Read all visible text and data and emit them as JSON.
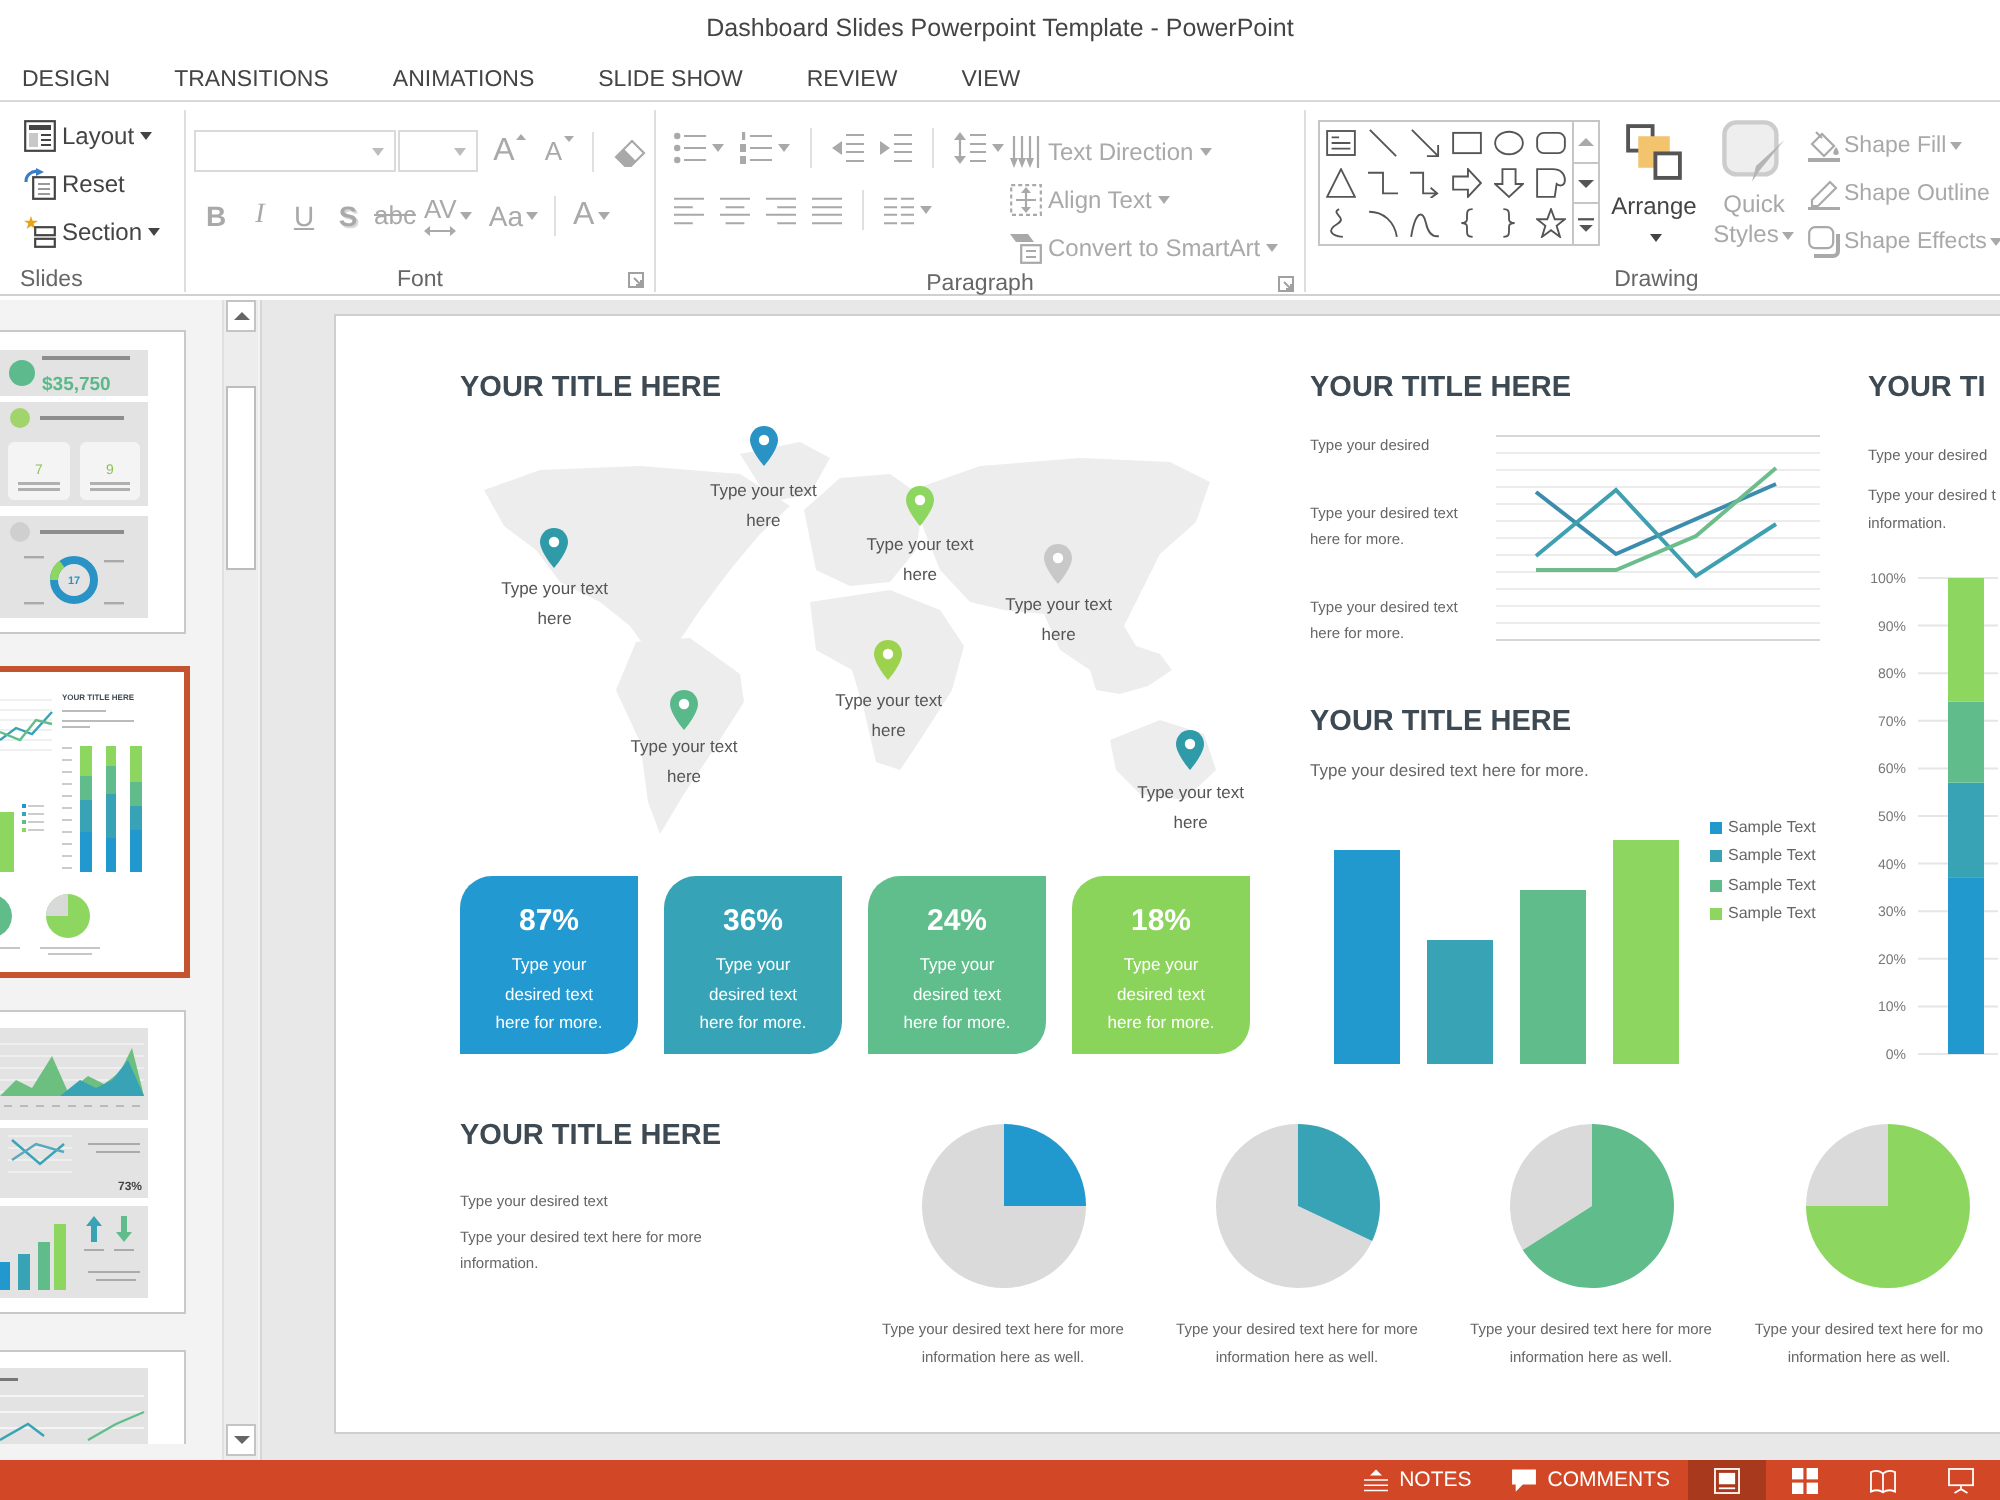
{
  "window": {
    "title": "Dashboard Slides Powerpoint Template - PowerPoint"
  },
  "tabs": [
    {
      "label": "DESIGN",
      "selected": false
    },
    {
      "label": "TRANSITIONS",
      "selected": false
    },
    {
      "label": "ANIMATIONS",
      "selected": false
    },
    {
      "label": "SLIDE SHOW",
      "selected": false
    },
    {
      "label": "REVIEW",
      "selected": false
    },
    {
      "label": "VIEW",
      "selected": false
    }
  ],
  "ribbon": {
    "slides_group": {
      "label": "Slides",
      "buttons": [
        {
          "label": "Layout",
          "menu": true,
          "disabled": false
        },
        {
          "label": "Reset",
          "menu": false,
          "disabled": false
        },
        {
          "label": "Section",
          "menu": true,
          "disabled": false
        }
      ]
    },
    "font_group": {
      "label": "Font",
      "font_name_field": {
        "disabled": true
      },
      "font_size_field": {
        "disabled": true
      },
      "size_buttons": [
        {
          "label": "A",
          "kind": "grow",
          "disabled": true
        },
        {
          "label": "A",
          "kind": "shrink",
          "disabled": true
        }
      ],
      "clear_button": {
        "disabled": true
      },
      "format_buttons": [
        {
          "label": "B",
          "kind": "bold",
          "menu": false,
          "disabled": true
        },
        {
          "label": "I",
          "kind": "italic",
          "menu": false,
          "disabled": true
        },
        {
          "label": "U",
          "kind": "underline",
          "menu": false,
          "disabled": true
        },
        {
          "label": "S",
          "kind": "shadow",
          "menu": false,
          "disabled": true
        },
        {
          "label": "abc",
          "kind": "strikethrough",
          "menu": false,
          "disabled": true
        },
        {
          "label": "AV",
          "kind": "spacing",
          "menu": true,
          "disabled": true
        },
        {
          "label": "Aa",
          "kind": "case",
          "menu": true,
          "disabled": true
        },
        {
          "label": "A",
          "kind": "color",
          "menu": true,
          "disabled": true
        }
      ]
    },
    "paragraph_group": {
      "label": "Paragraph",
      "list_buttons": [
        {
          "menu": true,
          "disabled": true
        },
        {
          "menu": true,
          "disabled": true
        },
        {
          "menu": false,
          "disabled": true
        },
        {
          "menu": false,
          "disabled": true
        },
        {
          "menu": true,
          "disabled": true
        }
      ],
      "align_buttons": [
        {
          "menu": false,
          "disabled": true
        },
        {
          "menu": false,
          "disabled": true
        },
        {
          "menu": false,
          "disabled": true
        },
        {
          "menu": false,
          "disabled": true
        },
        {
          "menu": true,
          "disabled": true
        }
      ],
      "text_buttons": [
        {
          "label": "Text Direction",
          "menu": true,
          "disabled": true
        },
        {
          "label": "Align Text",
          "menu": true,
          "disabled": true
        },
        {
          "label": "Convert to SmartArt",
          "menu": true,
          "disabled": true
        }
      ]
    },
    "drawing_group": {
      "label": "Drawing",
      "gallery_scroll": [
        {
          "disabled": true
        },
        {
          "disabled": false
        },
        {
          "disabled": false
        }
      ],
      "big_buttons": [
        {
          "label": "Arrange",
          "menu": true,
          "disabled": false
        },
        {
          "label": "Quick Styles",
          "menu": true,
          "disabled": true
        }
      ],
      "side_buttons": [
        {
          "label": "Shape Fill",
          "menu": true,
          "disabled": true
        },
        {
          "label": "Shape Outline",
          "menu": false,
          "disabled": true
        },
        {
          "label": "Shape Effects",
          "menu": true,
          "disabled": true
        }
      ]
    }
  },
  "thumbnails": [
    {
      "kind": "metrics",
      "selected": false,
      "texts": [
        "$35,750",
        "7",
        "9",
        "17"
      ]
    },
    {
      "kind": "dashboard",
      "selected": true,
      "texts": [
        "YOUR TITLE HERE"
      ]
    },
    {
      "kind": "trends",
      "selected": false,
      "texts": [
        "73%"
      ]
    },
    {
      "kind": "lines",
      "selected": false
    }
  ],
  "slide": {
    "map_section": {
      "title": "YOUR TITLE HERE",
      "pins": [
        {
          "label": "Type your text here",
          "color": "#2a93c5"
        },
        {
          "label": "Type your text here",
          "color": "#2f9aa8"
        },
        {
          "label": "Type your text here",
          "color": "#8dd65f"
        },
        {
          "label": "Type your text here",
          "color": "#c8c8c8"
        },
        {
          "label": "Type your text here",
          "color": "#9dd24f"
        },
        {
          "label": "Type your text here",
          "color": "#5ab98a"
        },
        {
          "label": "Type your text here",
          "color": "#2f9aa8"
        }
      ]
    },
    "stat_cards": [
      {
        "value": "87%",
        "text": "Type your desired text here for more.",
        "color": "#2299d0"
      },
      {
        "value": "36%",
        "text": "Type your desired text here for more.",
        "color": "#36a4b6"
      },
      {
        "value": "24%",
        "text": "Type your desired text here for more.",
        "color": "#5fbe8b"
      },
      {
        "value": "18%",
        "text": "Type your desired text here for more.",
        "color": "#8bd45c"
      }
    ],
    "trend_section": {
      "title": "YOUR TITLE HERE",
      "notes": [
        "Type your desired",
        "Type your desired text here for more.",
        "Type your desired text here for more."
      ]
    },
    "bar_section": {
      "title": "YOUR TITLE HERE",
      "text": "Type your desired text here for more.",
      "legend": [
        {
          "label": "Sample Text",
          "color": "#2199cf"
        },
        {
          "label": "Sample Text",
          "color": "#37a3b5"
        },
        {
          "label": "Sample Text",
          "color": "#60bd8b"
        },
        {
          "label": "Sample Text",
          "color": "#8dd65f"
        }
      ]
    },
    "stack_section": {
      "title": "YOUR TI",
      "texts": [
        "Type your desired",
        "Type your desired t",
        "information."
      ],
      "chart_data": {
        "type": "bar",
        "stacked": true,
        "grid": true,
        "ylim": [
          0,
          100
        ],
        "yticks": [
          {
            "value": 0,
            "label": "0%"
          },
          {
            "value": 10,
            "label": "10%"
          },
          {
            "value": 20,
            "label": "20%"
          },
          {
            "value": 30,
            "label": "30%"
          },
          {
            "value": 40,
            "label": "40%"
          },
          {
            "value": 50,
            "label": "50%"
          },
          {
            "value": 60,
            "label": "60%"
          },
          {
            "value": 70,
            "label": "70%"
          },
          {
            "value": 80,
            "label": "80%"
          },
          {
            "value": 90,
            "label": "90%"
          },
          {
            "value": 100,
            "label": "100%"
          }
        ],
        "series": [
          {
            "color": "#2199cf",
            "values": [
              37
            ]
          },
          {
            "color": "#37a3b5",
            "values": [
              20
            ]
          },
          {
            "color": "#60bd8b",
            "values": [
              17
            ]
          },
          {
            "color": "#8dd65f",
            "values": [
              26
            ]
          }
        ]
      }
    },
    "summary_section": {
      "title": "YOUR TITLE HERE",
      "texts": [
        "Type your desired text",
        "Type your desired text here for more information."
      ]
    },
    "pies": [
      {
        "caption": "Type your desired text here for more information here as well.",
        "color": "#2199cf"
      },
      {
        "caption": "Type your desired text here for more information here as well.",
        "color": "#37a3b5"
      },
      {
        "caption": "Type your desired text here for more information here as well.",
        "color": "#60bd8b"
      },
      {
        "caption": "Type your desired text here for mo information here as well.",
        "color": "#8dd65f"
      }
    ]
  },
  "status_bar": {
    "buttons": [
      {
        "label": "NOTES"
      },
      {
        "label": "COMMENTS"
      }
    ],
    "views": [
      {
        "selected": true
      },
      {
        "selected": false
      },
      {
        "selected": false
      },
      {
        "selected": false
      }
    ]
  }
}
